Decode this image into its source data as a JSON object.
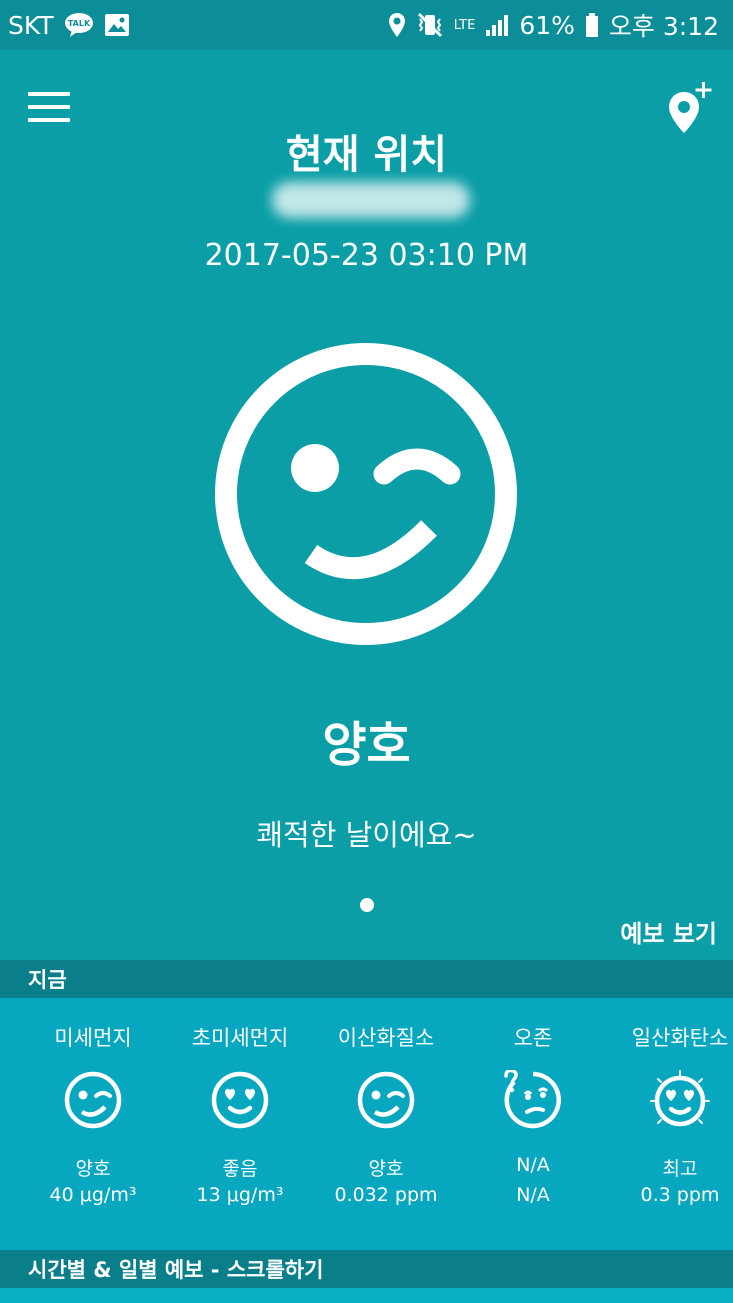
{
  "status_bar": {
    "carrier": "SKT",
    "talk_badge": "TALK",
    "network": "LTE",
    "battery": "61%",
    "time": "오후 3:12"
  },
  "header": {
    "title": "현재 위치",
    "datetime": "2017-05-23 03:10 PM"
  },
  "current": {
    "grade": "양호",
    "message": "쾌적한 날이에요~"
  },
  "forecast_link": "예보 보기",
  "now_section": {
    "label": "지금",
    "items": [
      {
        "name": "미세먼지",
        "grade": "양호",
        "value": "40 μg/m³",
        "icon": "wink-face-icon"
      },
      {
        "name": "초미세먼지",
        "grade": "좋음",
        "value": "13 μg/m³",
        "icon": "heart-eyes-face-icon"
      },
      {
        "name": "이산화질소",
        "grade": "양호",
        "value": "0.032 ppm",
        "icon": "wink-face-icon"
      },
      {
        "name": "오존",
        "grade": "N/A",
        "value": "N/A",
        "icon": "confused-face-icon"
      },
      {
        "name": "일산화탄소",
        "grade": "최고",
        "value": "0.3 ppm",
        "icon": "sparkle-heart-eyes-face-icon"
      }
    ]
  },
  "hourly_section": {
    "label": "시간별 & 일별 예보 - 스크롤하기"
  },
  "colors": {
    "background": "#0b9ea7",
    "status_bar": "#0b8e98",
    "section_header": "#0a7f89",
    "panel": "#06a7bf"
  }
}
